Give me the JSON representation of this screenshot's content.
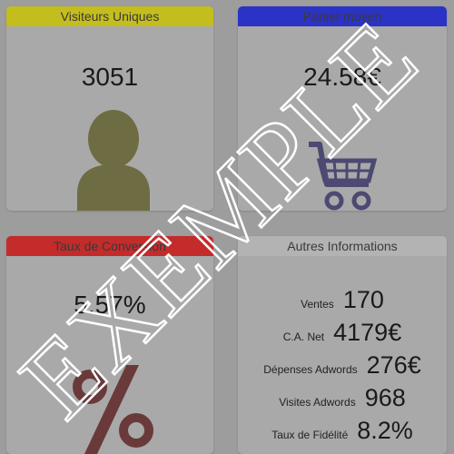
{
  "colors": {
    "page_bg": "#9d9d9d",
    "card_bg": "#a9a9a9",
    "visiteurs_header": "#c4bd1e",
    "panier_header": "#2b32c6",
    "conversion_header": "#c42b2b",
    "autres_header": "#b3b3b3",
    "person_icon": "#6e6c42",
    "cart_icon": "#4c4a72",
    "percent_icon": "#6a3a3a"
  },
  "cards": {
    "visiteurs": {
      "title": "Visiteurs Uniques",
      "value": "3051",
      "icon": "person-icon"
    },
    "panier": {
      "title": "Panier moyen",
      "value": "24.58€",
      "icon": "shopping-cart-icon"
    },
    "conversion": {
      "title": "Taux de Conversion",
      "value": "5.57%",
      "icon": "percent-icon"
    },
    "autres": {
      "title": "Autres Informations",
      "rows": [
        {
          "label": "Ventes",
          "value": "170"
        },
        {
          "label": "C.A. Net",
          "value": "4179€"
        },
        {
          "label": "Dépenses Adwords",
          "value": "276€"
        },
        {
          "label": "Visites Adwords",
          "value": "968"
        },
        {
          "label": "Taux de Fidélité",
          "value": "8.2%"
        }
      ]
    }
  },
  "watermark": {
    "text": "EXEMPLE"
  }
}
